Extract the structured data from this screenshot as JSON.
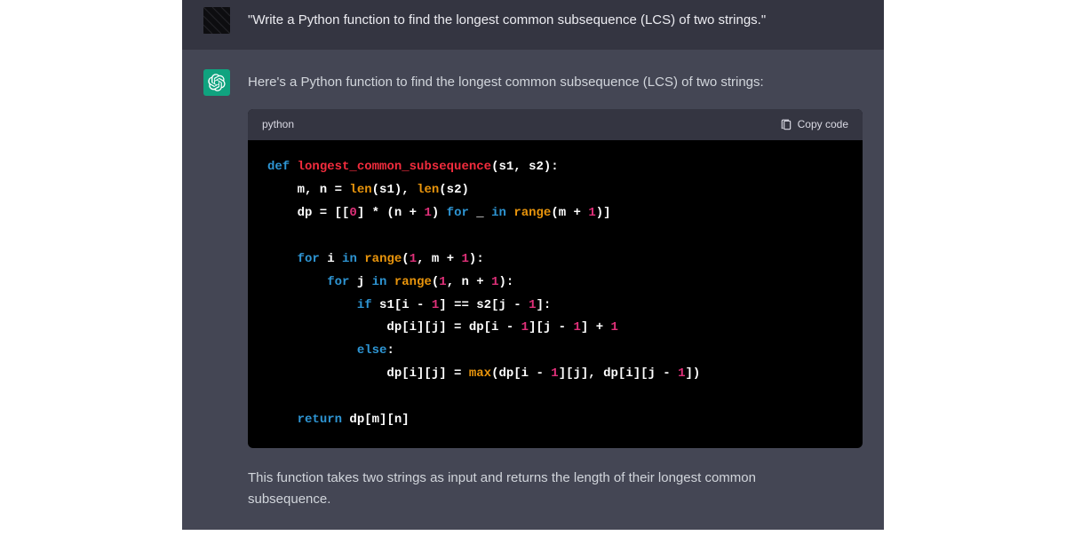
{
  "user_message": "\"Write a Python function to find the longest common subsequence (LCS) of two strings.\"",
  "assistant_intro": "Here's a Python function to find the longest common subsequence (LCS) of two strings:",
  "assistant_outro": "This function takes two strings as input and returns the length of their longest common",
  "assistant_outro2": "subsequence.",
  "code_lang": "python",
  "copy_label": "Copy code",
  "code": {
    "tokens": [
      [
        {
          "t": "def",
          "c": "kw"
        },
        {
          "t": " "
        },
        {
          "t": "longest_common_subsequence",
          "c": "fn"
        },
        {
          "t": "("
        },
        {
          "t": "s1, s2"
        },
        {
          "t": "):"
        }
      ],
      [
        {
          "t": "    m, n = "
        },
        {
          "t": "len",
          "c": "bi"
        },
        {
          "t": "(s1), "
        },
        {
          "t": "len",
          "c": "bi"
        },
        {
          "t": "(s2)"
        }
      ],
      [
        {
          "t": "    dp = [["
        },
        {
          "t": "0",
          "c": "num"
        },
        {
          "t": "] * (n + "
        },
        {
          "t": "1",
          "c": "num"
        },
        {
          "t": ") "
        },
        {
          "t": "for",
          "c": "kw"
        },
        {
          "t": " _ "
        },
        {
          "t": "in",
          "c": "kw"
        },
        {
          "t": " "
        },
        {
          "t": "range",
          "c": "bi"
        },
        {
          "t": "(m + "
        },
        {
          "t": "1",
          "c": "num"
        },
        {
          "t": ")]"
        }
      ],
      [],
      [
        {
          "t": "    "
        },
        {
          "t": "for",
          "c": "kw"
        },
        {
          "t": " i "
        },
        {
          "t": "in",
          "c": "kw"
        },
        {
          "t": " "
        },
        {
          "t": "range",
          "c": "bi"
        },
        {
          "t": "("
        },
        {
          "t": "1",
          "c": "num"
        },
        {
          "t": ", m + "
        },
        {
          "t": "1",
          "c": "num"
        },
        {
          "t": "):"
        }
      ],
      [
        {
          "t": "        "
        },
        {
          "t": "for",
          "c": "kw"
        },
        {
          "t": " j "
        },
        {
          "t": "in",
          "c": "kw"
        },
        {
          "t": " "
        },
        {
          "t": "range",
          "c": "bi"
        },
        {
          "t": "("
        },
        {
          "t": "1",
          "c": "num"
        },
        {
          "t": ", n + "
        },
        {
          "t": "1",
          "c": "num"
        },
        {
          "t": "):"
        }
      ],
      [
        {
          "t": "            "
        },
        {
          "t": "if",
          "c": "kw"
        },
        {
          "t": " s1[i - "
        },
        {
          "t": "1",
          "c": "num"
        },
        {
          "t": "] == s2[j - "
        },
        {
          "t": "1",
          "c": "num"
        },
        {
          "t": "]:"
        }
      ],
      [
        {
          "t": "                dp[i][j] = dp[i - "
        },
        {
          "t": "1",
          "c": "num"
        },
        {
          "t": "][j - "
        },
        {
          "t": "1",
          "c": "num"
        },
        {
          "t": "] + "
        },
        {
          "t": "1",
          "c": "num"
        }
      ],
      [
        {
          "t": "            "
        },
        {
          "t": "else",
          "c": "kw"
        },
        {
          "t": ":"
        }
      ],
      [
        {
          "t": "                dp[i][j] = "
        },
        {
          "t": "max",
          "c": "bi"
        },
        {
          "t": "(dp[i - "
        },
        {
          "t": "1",
          "c": "num"
        },
        {
          "t": "][j], dp[i][j - "
        },
        {
          "t": "1",
          "c": "num"
        },
        {
          "t": "])"
        }
      ],
      [],
      [
        {
          "t": "    "
        },
        {
          "t": "return",
          "c": "kw"
        },
        {
          "t": " dp[m][n]"
        }
      ]
    ]
  }
}
